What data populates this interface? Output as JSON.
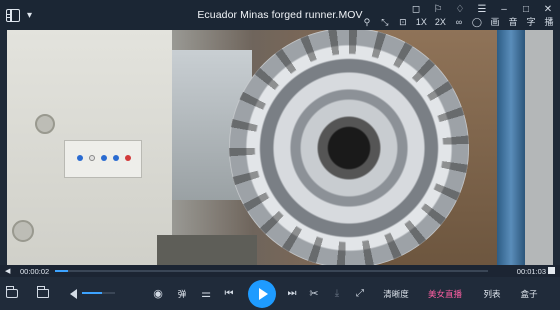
{
  "window": {
    "title": "Ecuador Minas  forged runner.MOV"
  },
  "title_icons": [
    "settings-icon",
    "minimize-icon",
    "skin-icon",
    "menu-icon",
    "window-minimize-icon",
    "window-maximize-icon",
    "window-close-icon"
  ],
  "toolbar2": {
    "items": [
      "1X",
      "2X",
      "画",
      "音",
      "字",
      "播"
    ]
  },
  "playback": {
    "current_time": "00:00:02",
    "total_time": "00:01:03",
    "progress": 0.03,
    "volume": 0.6
  },
  "controls": {
    "danmu_label": "弹",
    "clarity_label": "清晰度",
    "feature_label": "美女直播",
    "playlist_label": "列表",
    "box_label": "盒子"
  },
  "colors": {
    "accent": "#1e9bff",
    "pink": "#ff5fa3"
  }
}
